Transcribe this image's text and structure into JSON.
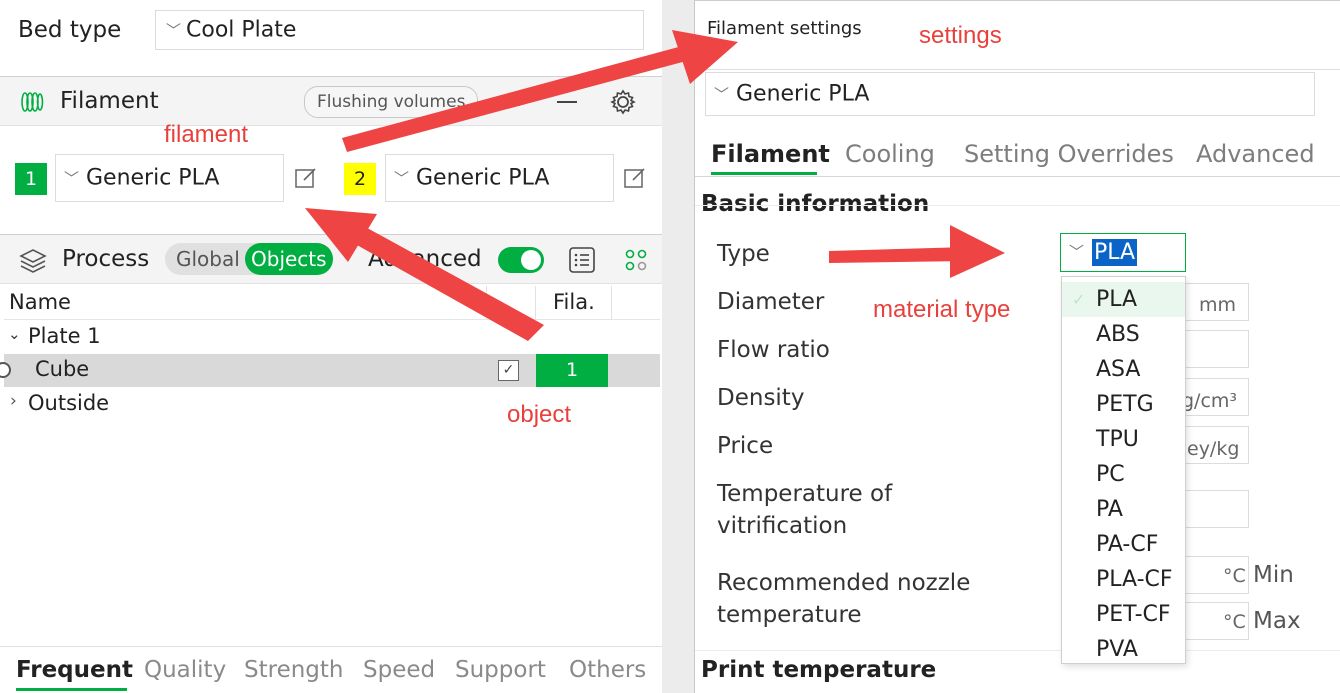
{
  "left": {
    "bed_type": {
      "label": "Bed type",
      "value": "Cool Plate"
    },
    "filament": {
      "title": "Filament",
      "flushing_button": "Flushing volumes",
      "slots": [
        {
          "number": "1",
          "color": "#00ae42",
          "preset": "Generic PLA"
        },
        {
          "number": "2",
          "color": "#ffff00",
          "preset": "Generic PLA"
        }
      ]
    },
    "process": {
      "title": "Process",
      "global_label": "Global",
      "objects_label": "Objects",
      "advanced_label": "Advanced",
      "advanced_on": true
    },
    "table": {
      "columns": [
        "Name",
        "Fila."
      ],
      "rows": [
        {
          "name": "Plate 1",
          "expanded": true
        },
        {
          "name": "Cube",
          "filament": "1",
          "selected": true
        },
        {
          "name": "Outside",
          "expanded": false
        }
      ]
    },
    "bottom_tabs": [
      "Frequent",
      "Quality",
      "Strength",
      "Speed",
      "Support",
      "Others"
    ]
  },
  "right": {
    "title": "Filament settings",
    "preset": "Generic PLA",
    "tabs": [
      "Filament",
      "Cooling",
      "Setting Overrides",
      "Advanced"
    ],
    "section": "Basic information",
    "fields": {
      "type": "Type",
      "diameter": "Diameter",
      "flow_ratio": "Flow ratio",
      "density": "Density",
      "price": "Price",
      "vitrification": "Temperature of vitrification",
      "vitrification_l1": "Temperature of",
      "vitrification_l2": "vitrification",
      "nozzle_temp_l1": "Recommended nozzle",
      "nozzle_temp_l2": "temperature"
    },
    "units": {
      "diameter": "mm",
      "density": "g/cm³",
      "price": "ey/kg",
      "celsius": "°C",
      "min": "Min",
      "max": "Max"
    },
    "type_value": "PLA",
    "type_options": [
      "PLA",
      "ABS",
      "ASA",
      "PETG",
      "TPU",
      "PC",
      "PA",
      "PA-CF",
      "PLA-CF",
      "PET-CF",
      "PVA"
    ],
    "next_section": "Print temperature"
  },
  "annotations": {
    "settings": "settings",
    "filament": "filament",
    "material_type": "material type",
    "object": "object",
    "color": "#e8413c"
  }
}
